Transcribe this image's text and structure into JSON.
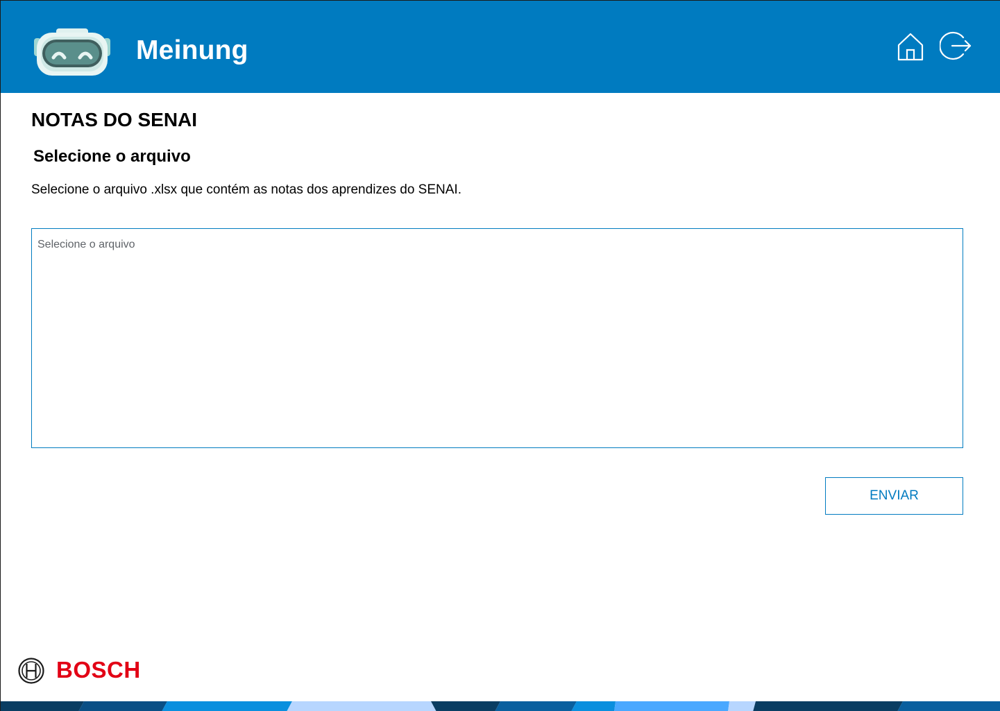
{
  "header": {
    "app_title": "Meinung",
    "logo_icon": "robot-mascot-icon",
    "actions": [
      {
        "name": "home",
        "icon": "home-icon"
      },
      {
        "name": "logout",
        "icon": "logout-icon"
      }
    ]
  },
  "main": {
    "page_title": "NOTAS DO SENAI",
    "section_title": "Selecione o arquivo",
    "description": "Selecione o arquivo .xlsx que contém as notas dos aprendizes do SENAI.",
    "file_input": {
      "placeholder": "Selecione o arquivo",
      "value": ""
    },
    "submit_label": "ENVIAR"
  },
  "footer": {
    "brand_name": "BOSCH",
    "brand_icon": "bosch-armature-icon"
  },
  "colors": {
    "header_bg": "#007bc0",
    "accent": "#007bc0",
    "brand_red": "#e20015"
  }
}
